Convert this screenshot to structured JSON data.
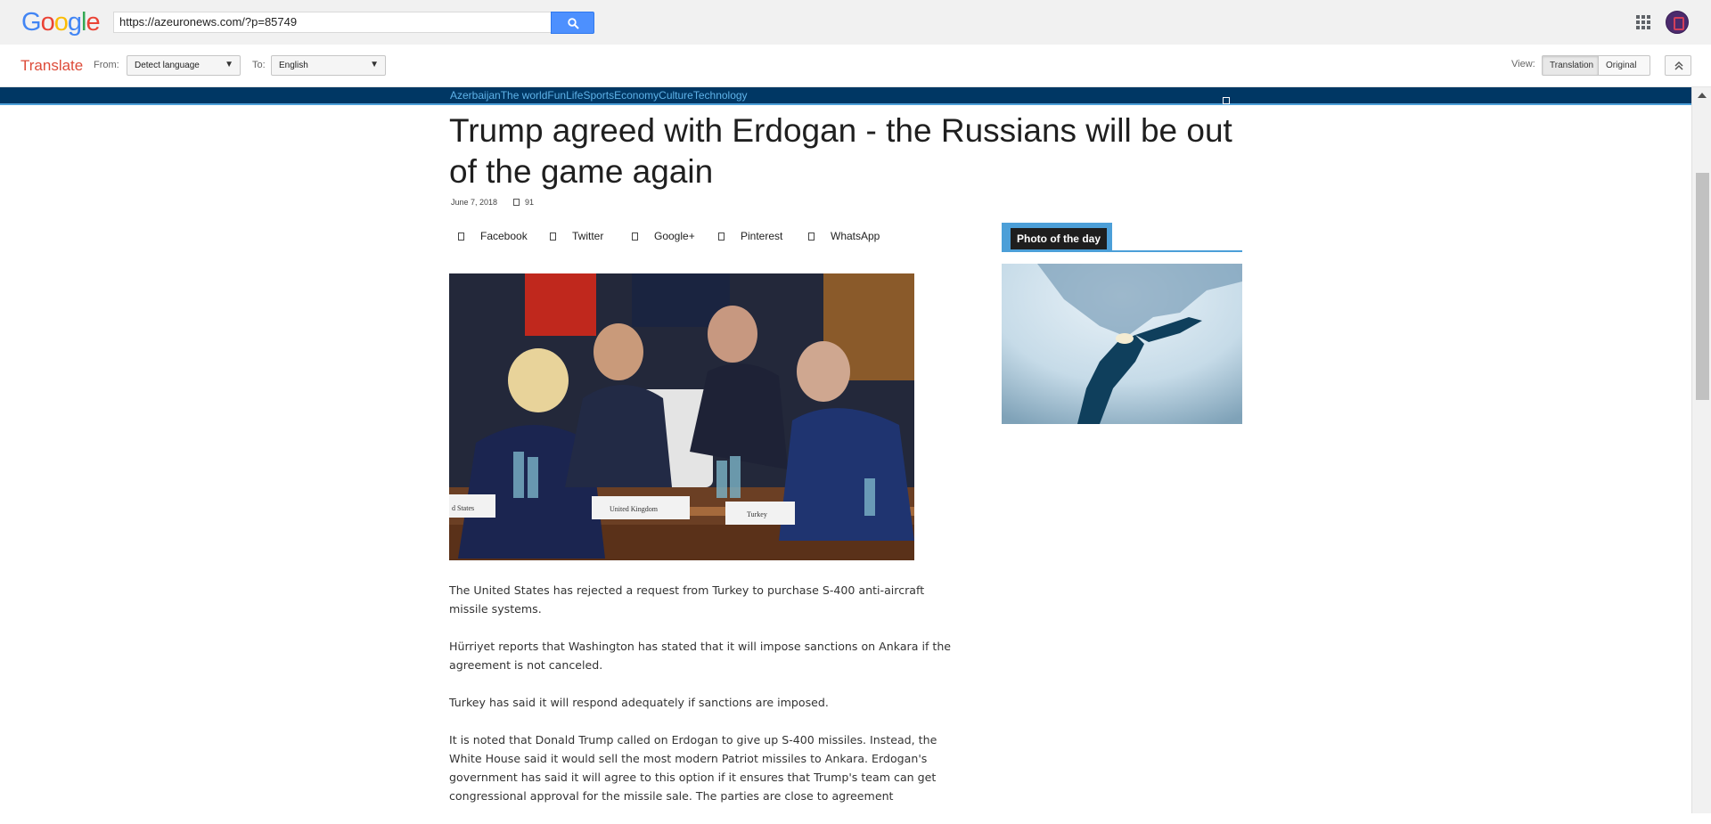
{
  "google_bar": {
    "logo": "Google",
    "url": "https://azeuronews.com/?p=85749"
  },
  "translate_bar": {
    "title": "Translate",
    "from_label": "From:",
    "from_value": "Detect language",
    "to_label": "To:",
    "to_value": "English",
    "view_label": "View:",
    "view_translation": "Translation",
    "view_original": "Original"
  },
  "site_nav": {
    "items": [
      "Azerbaijan",
      "The world",
      "Fun",
      "Life",
      "Sports",
      "Economy",
      "Culture",
      "Technology"
    ]
  },
  "article": {
    "title": "Trump agreed with Erdogan - the Russians will be out of the game again",
    "date": "June 7, 2018",
    "views": "91",
    "share": [
      "Facebook",
      "Twitter",
      "Google+",
      "Pinterest",
      "WhatsApp"
    ],
    "image_placards": [
      "d States",
      "United Kingdom",
      "Turkey"
    ],
    "paragraphs": [
      "The United States has rejected a request from Turkey to purchase S-400 anti-aircraft missile systems.",
      "Hürriyet reports that Washington has stated that it will impose sanctions on Ankara if the agreement is not canceled.",
      "Turkey has said it will respond adequately if sanctions are imposed.",
      "It is noted that Donald Trump called on Erdogan to give up S-400 missiles. Instead, the White House said it would sell the most modern Patriot missiles to Ankara. Erdogan's government has said it will agree to this option if it ensures that Trump's team can get congressional approval for the missile sale. The parties are close to agreement"
    ]
  },
  "sidebar": {
    "photo_of_day_label": "Photo of the day"
  },
  "colors": {
    "translate_red": "#dd4b39",
    "nav_bg": "#003764",
    "nav_link": "#5eb2e8",
    "accent_blue": "#4c9fd8",
    "search_blue": "#4d90fe"
  }
}
